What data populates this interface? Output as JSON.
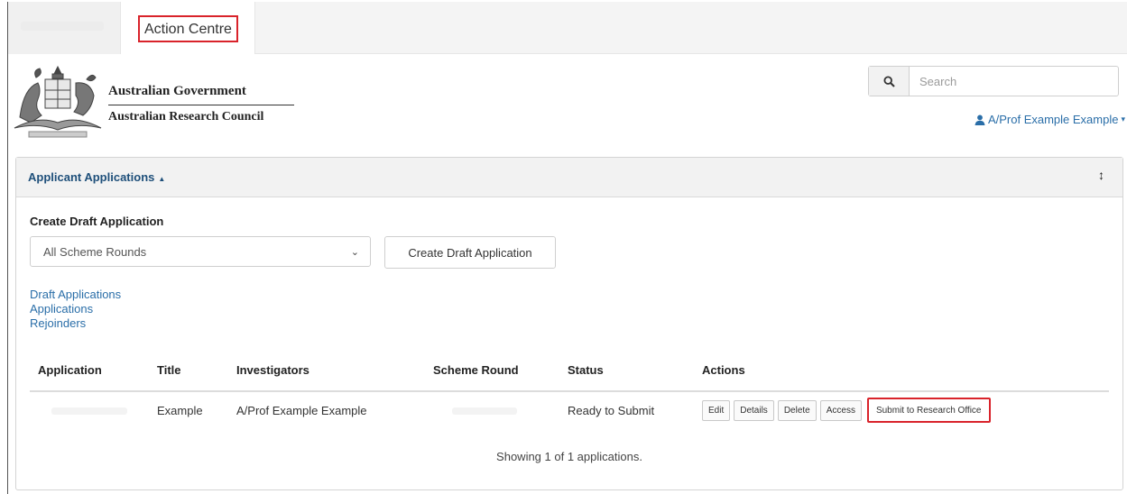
{
  "tabs": {
    "active_label": "Action Centre"
  },
  "header": {
    "gov_name": "Australian Government",
    "council_name": "Australian Research Council",
    "search_placeholder": "Search",
    "user_name": "A/Prof Example Example"
  },
  "panel": {
    "title": "Applicant Applications",
    "create_label": "Create Draft Application",
    "scheme_selected": "All Scheme Rounds",
    "create_button": "Create Draft Application",
    "links": [
      "Draft Applications",
      "Applications",
      "Rejoinders"
    ]
  },
  "table": {
    "headers": [
      "Application",
      "Title",
      "Investigators",
      "Scheme Round",
      "Status",
      "Actions"
    ],
    "rows": [
      {
        "title": "Example",
        "investigators": "A/Prof Example Example",
        "status": "Ready to Submit",
        "actions": [
          "Edit",
          "Details",
          "Delete",
          "Access",
          "Submit to Research Office"
        ]
      }
    ],
    "footer": "Showing 1 of 1 applications."
  },
  "colors": {
    "highlight": "#d9232b",
    "link": "#2a6ea8",
    "panel_title": "#1e4f7a"
  }
}
